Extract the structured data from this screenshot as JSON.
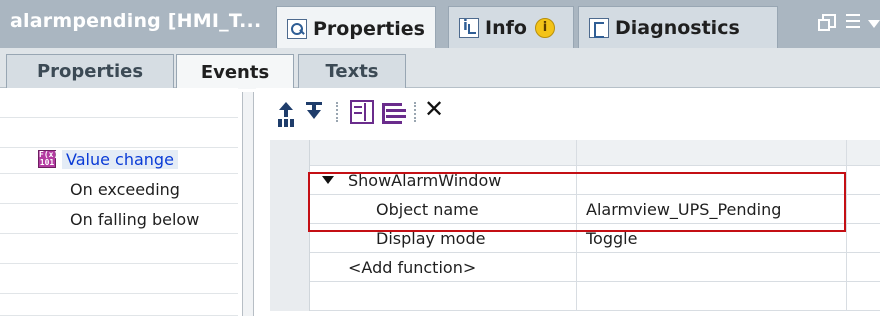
{
  "window": {
    "title": "alarmpending  [HMI_T...",
    "tabs": [
      {
        "label": "Properties",
        "icon": "properties-icon",
        "active": true
      },
      {
        "label": "Info",
        "icon": "info-icon",
        "badge": "i"
      },
      {
        "label": "Diagnostics",
        "icon": "diagnostics-icon"
      }
    ]
  },
  "subtabs": [
    {
      "label": "Properties"
    },
    {
      "label": "Events",
      "active": true
    },
    {
      "label": "Texts"
    }
  ],
  "events": {
    "items": [
      {
        "label": "Value change",
        "selected": true,
        "icon": "event-icon"
      },
      {
        "label": "On exceeding"
      },
      {
        "label": "On falling below"
      }
    ]
  },
  "toolbar": {
    "buttons": [
      "move-up-icon",
      "move-down-icon",
      "expand-icon",
      "collapse-icon",
      "delete-icon"
    ]
  },
  "function_list": {
    "rows": [
      {
        "label": "ShowAlarmWindow",
        "value": "",
        "expanded": true
      },
      {
        "label": "Object name",
        "value": "Alarmview_UPS_Pending"
      },
      {
        "label": "Display mode",
        "value": "Toggle"
      },
      {
        "label": "<Add function>",
        "value": ""
      }
    ]
  },
  "colors": {
    "titlebar": "#aab6c1",
    "highlight": "#c40f14",
    "selected_text": "#0a3bd6"
  }
}
